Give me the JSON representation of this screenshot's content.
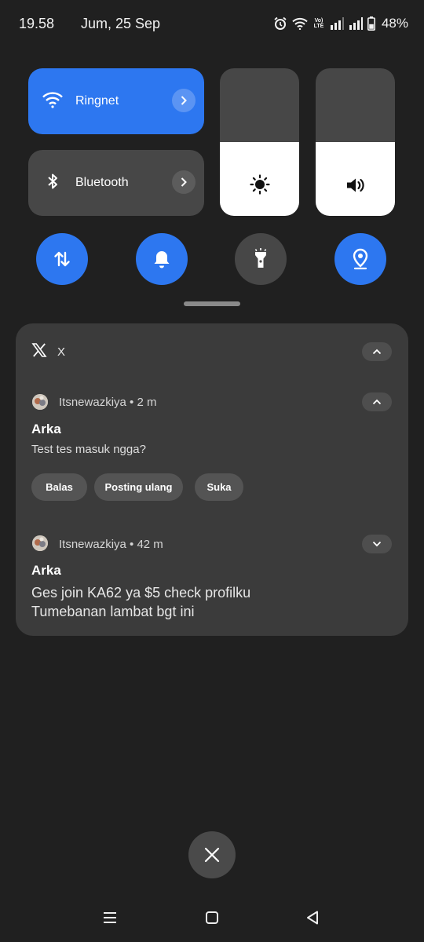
{
  "status_bar": {
    "time": "19.58",
    "date": "Jum, 25 Sep",
    "volte_label": "Vo) LTE",
    "battery_percent": "48%",
    "battery_level": 0.48,
    "icons": [
      "alarm-icon",
      "wifi-icon",
      "volte-icon",
      "signal-icon",
      "signal-icon",
      "battery-icon"
    ]
  },
  "quick_settings": {
    "wifi": {
      "label": "Ringnet",
      "active": true,
      "icon": "wifi-icon"
    },
    "bluetooth": {
      "label": "Bluetooth",
      "active": false,
      "icon": "bluetooth-icon"
    },
    "brightness": {
      "level": 0.5,
      "icon": "sun-icon"
    },
    "volume": {
      "level": 0.5,
      "icon": "speaker-icon"
    },
    "toggles": [
      {
        "name": "mobile-data",
        "icon": "data-transfer-icon",
        "active": true
      },
      {
        "name": "sound",
        "icon": "bell-icon",
        "active": true
      },
      {
        "name": "flashlight",
        "icon": "flashlight-icon",
        "active": false
      },
      {
        "name": "location",
        "icon": "location-pin-icon",
        "active": true
      }
    ]
  },
  "notification_group": {
    "app_name": "X",
    "app_icon": "x-logo-icon",
    "notifications": [
      {
        "meta": "Itsnewazkiya • 2 m",
        "sender": "Arka",
        "message": "Test tes masuk ngga?",
        "expanded": true,
        "actions": [
          "Balas",
          "Posting ulang",
          "Suka"
        ]
      },
      {
        "meta": "Itsnewazkiya • 42 m",
        "sender": "Arka",
        "message_line1": "Ges join KA62 ya $5 check profilku",
        "message_line2": "Tumebanan lambat bgt ini",
        "expanded": false
      }
    ]
  },
  "clear_all_icon": "close-icon",
  "nav_bar": [
    "recents-icon",
    "home-icon",
    "back-icon"
  ],
  "colors": {
    "background": "#202020",
    "accent": "#2d77f0",
    "tile_inactive": "#474747",
    "card": "#3b3b3b"
  }
}
